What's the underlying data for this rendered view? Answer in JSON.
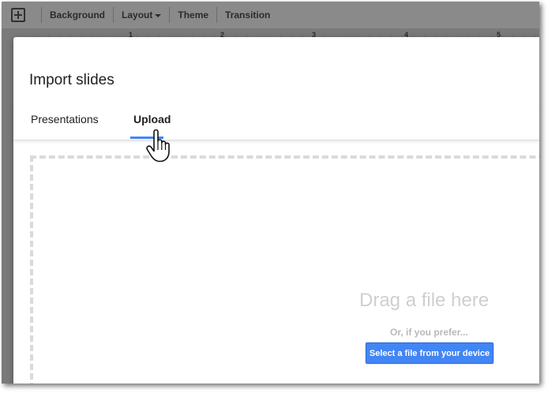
{
  "toolbar": {
    "add_icon": "add-slide-icon",
    "background_label": "Background",
    "layout_label": "Layout",
    "theme_label": "Theme",
    "transition_label": "Transition"
  },
  "ruler": {
    "marks": [
      "1",
      "2",
      "3",
      "4",
      "5"
    ]
  },
  "dialog": {
    "title": "Import slides",
    "tabs": [
      {
        "label": "Presentations",
        "selected": false
      },
      {
        "label": "Upload",
        "selected": true
      }
    ],
    "dropzone": {
      "drag_text": "Drag a file here",
      "prefer_text": "Or, if you prefer...",
      "select_button_label": "Select a file from your device"
    }
  },
  "colors": {
    "accent": "#4285f4",
    "toolbar_bg": "#8a8a8a",
    "overlay": "#7a7a7a"
  },
  "cursor_icon": "hand-pointer-icon"
}
